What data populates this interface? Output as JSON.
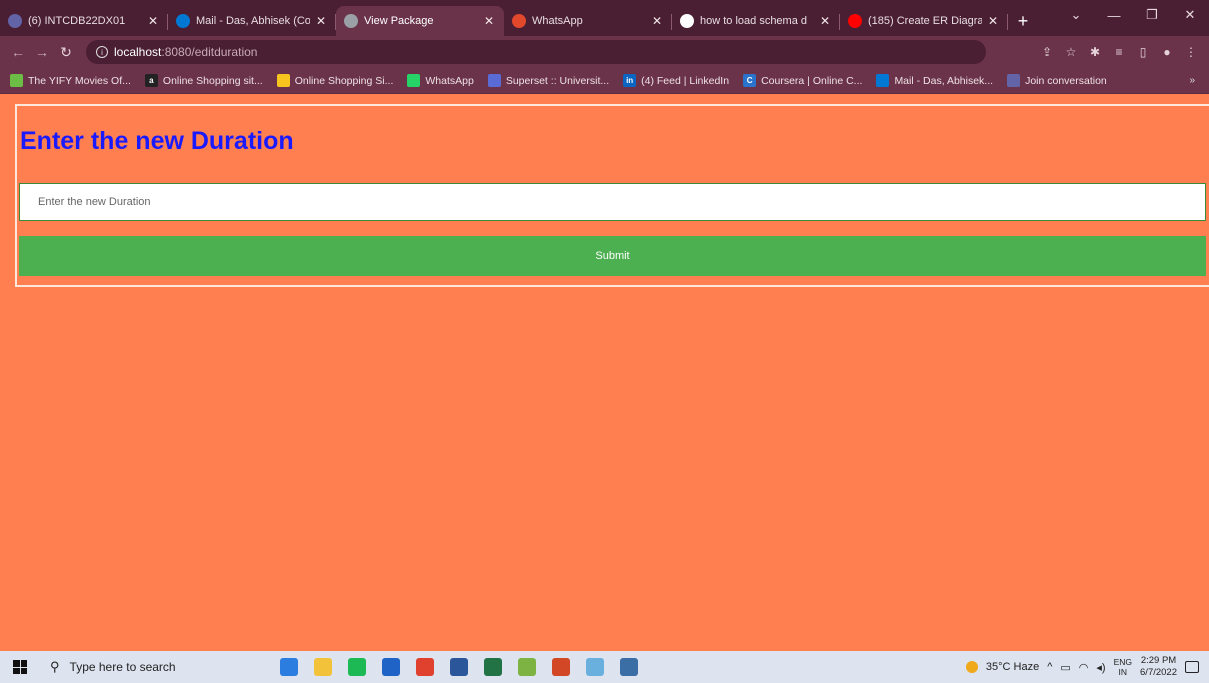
{
  "browser": {
    "tabs": [
      {
        "label": "(6) INTCDB22DX01",
        "icon": "teams-icon",
        "icon_color": "#6264a7",
        "active": false
      },
      {
        "label": "Mail - Das, Abhisek (Co",
        "icon": "outlook-icon",
        "icon_color": "#0078d4",
        "active": false
      },
      {
        "label": "View Package",
        "icon": "globe-icon",
        "icon_color": "#9aa0a6",
        "active": true
      },
      {
        "label": "WhatsApp",
        "icon": "whatsapp-icon",
        "icon_color": "#e2482c",
        "active": false
      },
      {
        "label": "how to load schema d",
        "icon": "google-icon",
        "icon_color": "#ffffff",
        "active": false
      },
      {
        "label": "(185) Create ER Diagra",
        "icon": "youtube-icon",
        "icon_color": "#ff0000",
        "active": false
      }
    ],
    "new_tab_label": "+",
    "address": {
      "host": "localhost",
      "path": ":8080/editduration"
    },
    "bookmarks": [
      {
        "label": "The YIFY Movies Of...",
        "icon": "yify-icon",
        "color": "#6bbd45"
      },
      {
        "label": "Online Shopping sit...",
        "icon": "amazon-icon",
        "color": "#222222",
        "glyph": "a"
      },
      {
        "label": "Online Shopping Si...",
        "icon": "flipkart-icon",
        "color": "#f7c51e"
      },
      {
        "label": "WhatsApp",
        "icon": "whatsapp-icon",
        "color": "#25d366"
      },
      {
        "label": "Superset :: Universit...",
        "icon": "superset-icon",
        "color": "#5b6bd6"
      },
      {
        "label": "(4) Feed | LinkedIn",
        "icon": "linkedin-icon",
        "color": "#0a66c2",
        "glyph": "in"
      },
      {
        "label": "Coursera | Online C...",
        "icon": "coursera-icon",
        "color": "#2a73cc",
        "glyph": "C"
      },
      {
        "label": "Mail - Das, Abhisek...",
        "icon": "outlook-icon",
        "color": "#0078d4"
      },
      {
        "label": "Join conversation",
        "icon": "teams-icon",
        "color": "#6264a7"
      }
    ]
  },
  "page": {
    "heading": "Enter the new Duration",
    "duration_input": {
      "placeholder": "Enter the new Duration",
      "value": ""
    },
    "submit_label": "Submit",
    "colors": {
      "background": "#ff7f50",
      "heading": "#1a1aff",
      "button": "#4caf50"
    }
  },
  "taskbar": {
    "search_placeholder": "Type here to search",
    "weather": "35°C Haze",
    "lang_top": "ENG",
    "lang_bottom": "IN",
    "time": "2:29 PM",
    "date": "6/7/2022",
    "apps": [
      {
        "name": "mail-app-icon",
        "color": "#2b7de0"
      },
      {
        "name": "file-explorer-icon",
        "color": "#f3c23b"
      },
      {
        "name": "spotify-icon",
        "color": "#1db954"
      },
      {
        "name": "store-icon",
        "color": "#2063c7"
      },
      {
        "name": "chrome-icon",
        "color": "#e0412f"
      },
      {
        "name": "word-icon",
        "color": "#2b579a"
      },
      {
        "name": "excel-icon",
        "color": "#217346"
      },
      {
        "name": "eclipse-icon",
        "color": "#7cb342"
      },
      {
        "name": "powerpoint-icon",
        "color": "#d24726"
      },
      {
        "name": "paint-icon",
        "color": "#6ab0de"
      },
      {
        "name": "terminal-icon",
        "color": "#3a6ea5"
      }
    ]
  }
}
